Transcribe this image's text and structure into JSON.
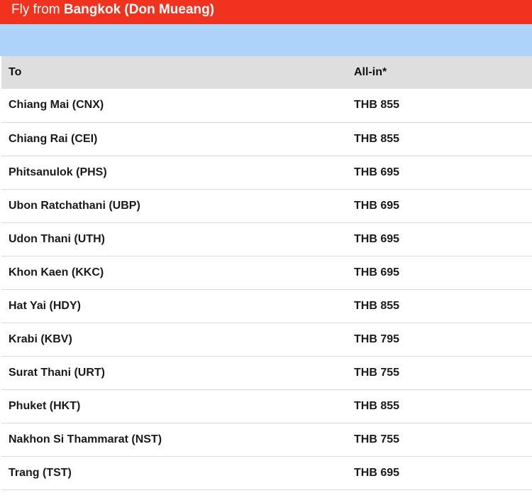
{
  "header": {
    "prefix": "Fly from",
    "origin": "Bangkok (Don Mueang)",
    "background_color": "#f0321e"
  },
  "banner": {
    "background_color": "#aed3fb"
  },
  "table": {
    "columns": [
      "To",
      "All-in*"
    ],
    "rows": [
      {
        "destination": "Chiang Mai (CNX)",
        "price": "THB 855"
      },
      {
        "destination": "Chiang Rai (CEI)",
        "price": "THB 855"
      },
      {
        "destination": "Phitsanulok (PHS)",
        "price": "THB 695"
      },
      {
        "destination": "Ubon Ratchathani (UBP)",
        "price": "THB 695"
      },
      {
        "destination": "Udon Thani (UTH)",
        "price": "THB 695"
      },
      {
        "destination": "Khon Kaen (KKC)",
        "price": "THB 695"
      },
      {
        "destination": "Hat Yai (HDY)",
        "price": "THB 855"
      },
      {
        "destination": "Krabi (KBV)",
        "price": "THB 795"
      },
      {
        "destination": "Surat Thani (URT)",
        "price": "THB 755"
      },
      {
        "destination": "Phuket (HKT)",
        "price": "THB 855"
      },
      {
        "destination": "Nakhon Si Thammarat (NST)",
        "price": "THB 755"
      },
      {
        "destination": "Trang (TST)",
        "price": "THB 695"
      }
    ]
  }
}
